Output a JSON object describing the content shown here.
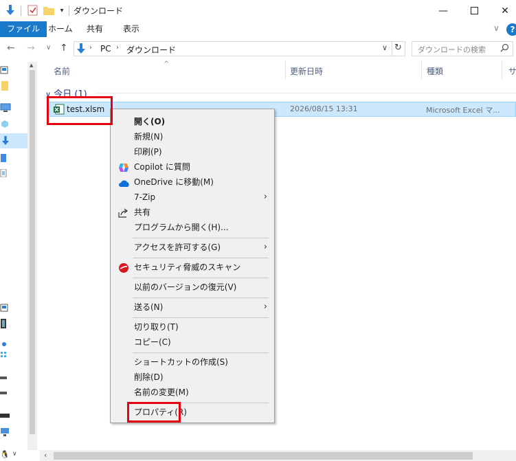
{
  "window": {
    "title": "ダウンロード"
  },
  "ribbon": {
    "tabs": [
      "ファイル",
      "ホーム",
      "共有",
      "表示"
    ],
    "help": "?"
  },
  "address": {
    "path": [
      "PC",
      "ダウンロード"
    ]
  },
  "search": {
    "placeholder": "ダウンロードの検索"
  },
  "columns": {
    "name": "名前",
    "date": "更新日時",
    "type": "種類",
    "size": "サ"
  },
  "group": {
    "label": "今日 (1)"
  },
  "file": {
    "name": "test.xlsm",
    "date": "2026/08/15 13:31",
    "type": "Microsoft Excel マ..."
  },
  "context_menu": {
    "items": [
      {
        "label": "開く(O)",
        "bold": true
      },
      {
        "label": "新規(N)"
      },
      {
        "label": "印刷(P)"
      },
      {
        "label": "Copilot に質問",
        "icon": "copilot-icon"
      },
      {
        "label": "OneDrive に移動(M)",
        "icon": "onedrive-icon"
      },
      {
        "label": "7-Zip",
        "submenu": true
      },
      {
        "label": "共有",
        "icon": "share-icon"
      },
      {
        "label": "プログラムから開く(H)..."
      },
      {
        "label": "アクセスを許可する(G)",
        "submenu": true
      },
      {
        "label": "セキュリティ脅威のスキャン",
        "icon": "trendmicro-icon"
      },
      {
        "label": "以前のバージョンの復元(V)"
      },
      {
        "label": "送る(N)",
        "submenu": true
      },
      {
        "label": "切り取り(T)"
      },
      {
        "label": "コピー(C)"
      },
      {
        "label": "ショートカットの作成(S)"
      },
      {
        "label": "削除(D)"
      },
      {
        "label": "名前の変更(M)"
      },
      {
        "label": "プロパティ(R)"
      }
    ]
  },
  "colors": {
    "accent": "#1979ca",
    "selection": "#cce8ff",
    "highlight_box": "#e60012"
  }
}
